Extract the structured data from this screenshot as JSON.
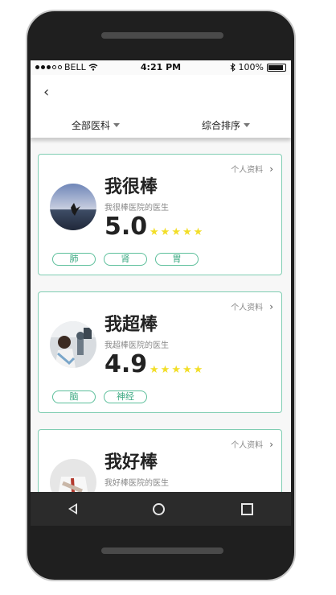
{
  "status_bar": {
    "carrier": "BELL",
    "time": "4:21 PM",
    "battery": "100%",
    "icons": [
      "signal-dots-icon",
      "wifi-icon",
      "bluetooth-icon",
      "battery-icon"
    ]
  },
  "nav": {
    "back_icon": "chevron-left-icon",
    "back_glyph": "‹"
  },
  "filters": [
    {
      "label": "全部医科"
    },
    {
      "label": "综合排序"
    }
  ],
  "doctors": [
    {
      "name": "我很棒",
      "hospital": "我很棒医院的医生",
      "score": "5.0",
      "stars": 5,
      "profile_link": "个人资料",
      "tags": [
        "肺",
        "肾",
        "胃"
      ]
    },
    {
      "name": "我超棒",
      "hospital": "我超棒医院的医生",
      "score": "4.9",
      "stars": 5,
      "profile_link": "个人资料",
      "tags": [
        "脑",
        "神经"
      ]
    },
    {
      "name": "我好棒",
      "hospital": "我好棒医院的医生",
      "profile_link": "个人资料"
    }
  ],
  "colors": {
    "card_border": "#7fcdb2",
    "tag_text": "#3aa880",
    "star": "#f2de28",
    "android_bar": "#2b2b2b"
  }
}
